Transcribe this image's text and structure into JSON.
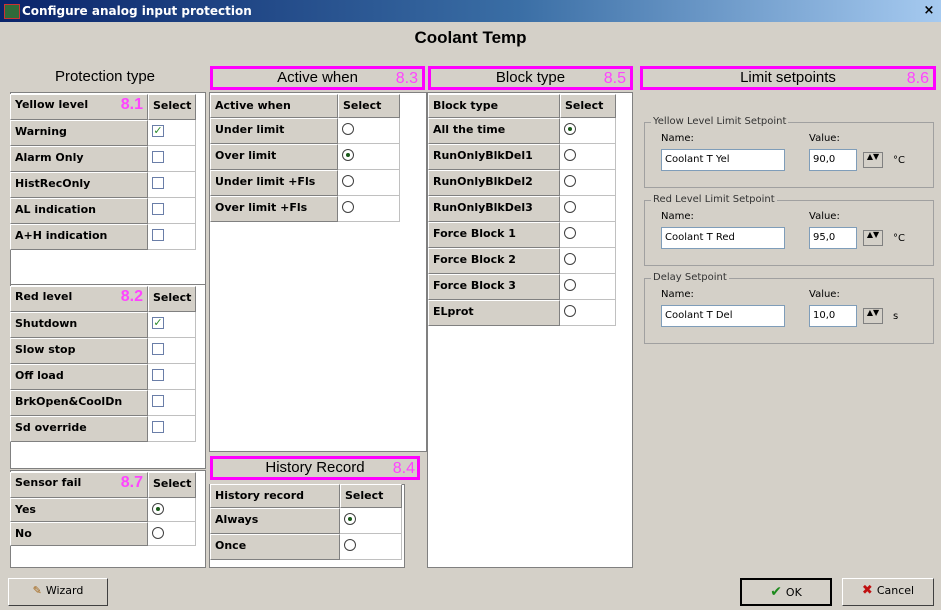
{
  "window": {
    "title": "Configure analog input protection",
    "close_glyph": "×"
  },
  "main_title": "Coolant Temp",
  "markers": {
    "m81": "8.1",
    "m82": "8.2",
    "m83": "8.3",
    "m84": "8.4",
    "m85": "8.5",
    "m86": "8.6",
    "m87": "8.7"
  },
  "headers": {
    "protection_type": "Protection type",
    "active_when": "Active when",
    "block_type": "Block type",
    "limit_setpoints": "Limit setpoints",
    "history_record": "History Record"
  },
  "yellow": {
    "header": "Yellow level",
    "select": "Select",
    "rows": [
      {
        "label": "Warning",
        "checked": true
      },
      {
        "label": "Alarm Only",
        "checked": false
      },
      {
        "label": "HistRecOnly",
        "checked": false
      },
      {
        "label": "AL indication",
        "checked": false
      },
      {
        "label": "A+H indication",
        "checked": false
      }
    ]
  },
  "red": {
    "header": "Red level",
    "select": "Select",
    "rows": [
      {
        "label": "Shutdown",
        "checked": true
      },
      {
        "label": "Slow stop",
        "checked": false
      },
      {
        "label": "Off load",
        "checked": false
      },
      {
        "label": "BrkOpen&CoolDn",
        "checked": false
      },
      {
        "label": "Sd override",
        "checked": false
      }
    ]
  },
  "sensor": {
    "header": "Sensor fail",
    "select": "Select",
    "rows": [
      {
        "label": "Yes",
        "selected": true
      },
      {
        "label": "No",
        "selected": false
      }
    ]
  },
  "active": {
    "header": "Active when",
    "select": "Select",
    "rows": [
      {
        "label": "Under limit",
        "selected": false
      },
      {
        "label": "Over limit",
        "selected": true
      },
      {
        "label": "Under limit +Fls",
        "selected": false
      },
      {
        "label": "Over limit +Fls",
        "selected": false
      }
    ]
  },
  "history": {
    "header": "History record",
    "select": "Select",
    "rows": [
      {
        "label": "Always",
        "selected": true
      },
      {
        "label": "Once",
        "selected": false
      }
    ]
  },
  "block": {
    "header": "Block type",
    "select": "Select",
    "rows": [
      {
        "label": "All the time",
        "selected": true
      },
      {
        "label": "RunOnlyBlkDel1",
        "selected": false
      },
      {
        "label": "RunOnlyBlkDel2",
        "selected": false
      },
      {
        "label": "RunOnlyBlkDel3",
        "selected": false
      },
      {
        "label": "Force Block 1",
        "selected": false
      },
      {
        "label": "Force Block 2",
        "selected": false
      },
      {
        "label": "Force Block 3",
        "selected": false
      },
      {
        "label": "ELprot",
        "selected": false
      }
    ]
  },
  "setpoints": [
    {
      "group": "Yellow Level Limit Setpoint",
      "name_label": "Name:",
      "value_label": "Value:",
      "name": "Coolant T Yel",
      "value": "90,0",
      "unit": "°C"
    },
    {
      "group": "Red Level Limit Setpoint",
      "name_label": "Name:",
      "value_label": "Value:",
      "name": "Coolant T Red",
      "value": "95,0",
      "unit": "°C"
    },
    {
      "group": "Delay Setpoint",
      "name_label": "Name:",
      "value_label": "Value:",
      "name": "Coolant T Del",
      "value": "10,0",
      "unit": "s"
    }
  ],
  "spin_glyph": "▲▼",
  "icons": {
    "check": "✓",
    "radio": "◯",
    "wizard": "✎",
    "ok": "✔",
    "cancel": "✖"
  },
  "buttons": {
    "wizard": "Wizard",
    "ok": "OK",
    "cancel": "Cancel"
  }
}
